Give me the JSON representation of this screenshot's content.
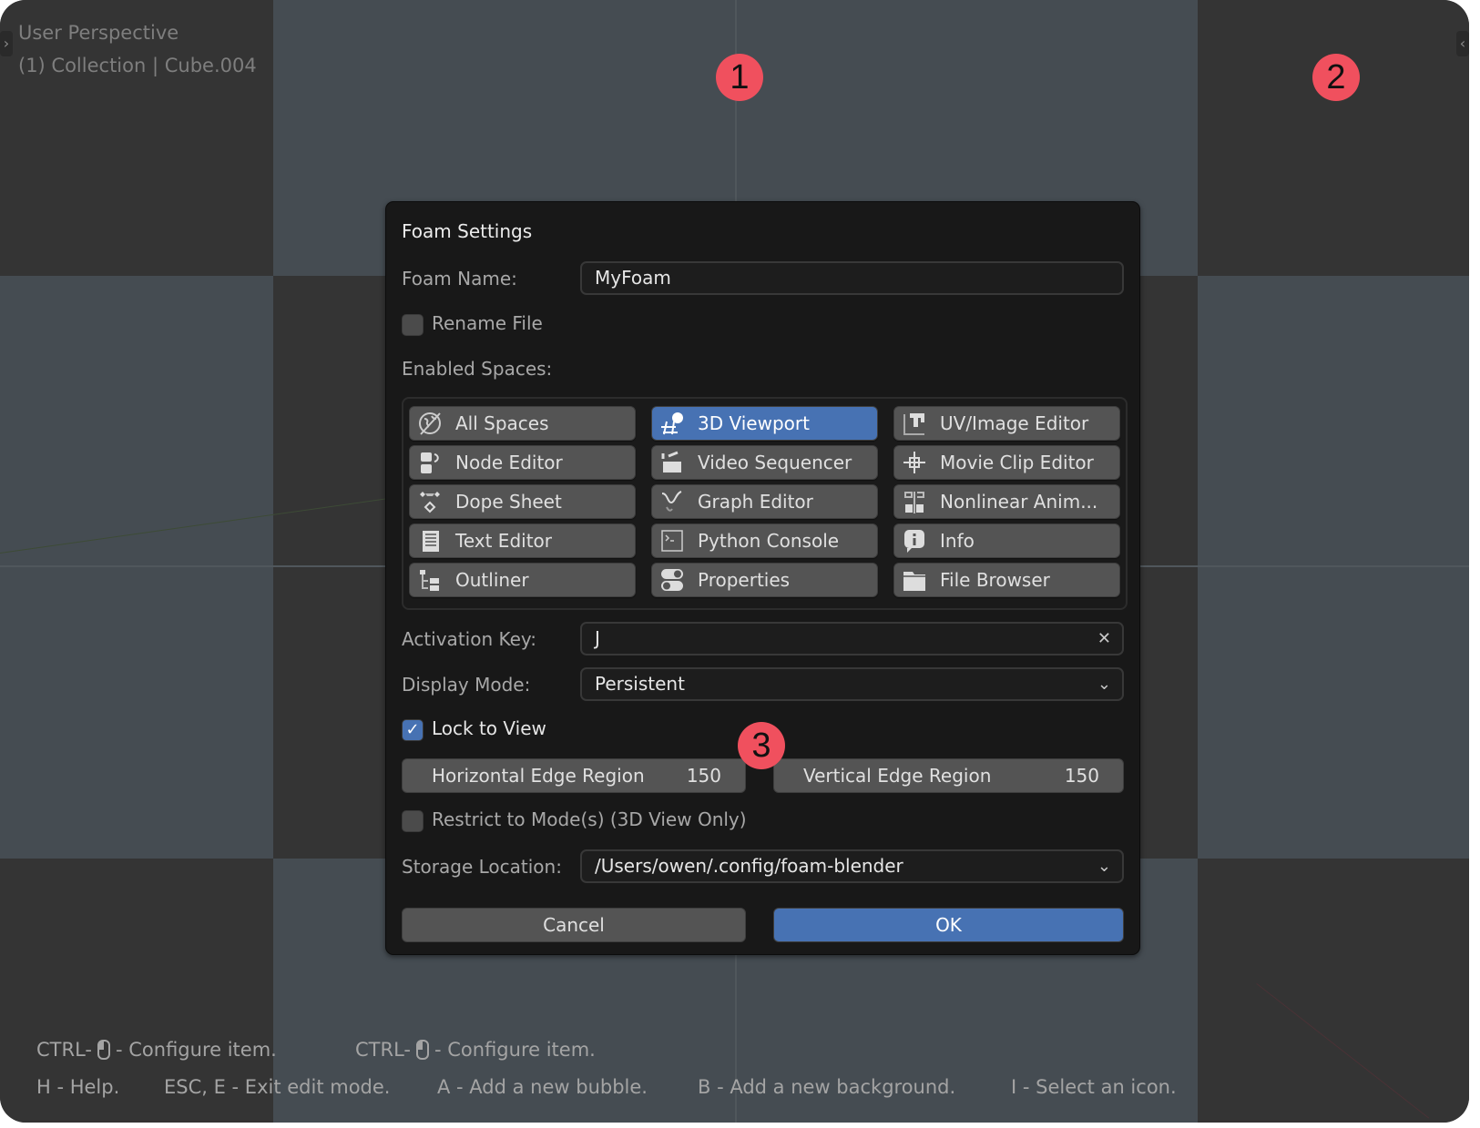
{
  "viewport": {
    "perspective_label": "User Perspective",
    "collection_label": "(1) Collection | Cube.004",
    "left_tab_icon": "chevron-right",
    "right_tab_icon": "chevron-left"
  },
  "badges": [
    "1",
    "2",
    "3"
  ],
  "dialog": {
    "title": "Foam Settings",
    "foam_name_label": "Foam Name:",
    "foam_name_value": "MyFoam",
    "rename_file_label": "Rename File",
    "rename_file_checked": false,
    "enabled_spaces_label": "Enabled Spaces:",
    "spaces": [
      {
        "label": "All Spaces",
        "icon": "globe-icon",
        "selected": false
      },
      {
        "label": "3D Viewport",
        "icon": "viewport-3d-icon",
        "selected": true
      },
      {
        "label": "UV/Image Editor",
        "icon": "image-editor-icon",
        "selected": false
      },
      {
        "label": "Node Editor",
        "icon": "node-editor-icon",
        "selected": false
      },
      {
        "label": "Video Sequencer",
        "icon": "clapper-icon",
        "selected": false
      },
      {
        "label": "Movie Clip Editor",
        "icon": "crosshair-icon",
        "selected": false
      },
      {
        "label": "Dope Sheet",
        "icon": "keyframe-icon",
        "selected": false
      },
      {
        "label": "Graph Editor",
        "icon": "curve-icon",
        "selected": false
      },
      {
        "label": "Nonlinear Anim...",
        "icon": "nla-icon",
        "selected": false
      },
      {
        "label": "Text Editor",
        "icon": "text-doc-icon",
        "selected": false
      },
      {
        "label": "Python Console",
        "icon": "console-icon",
        "selected": false
      },
      {
        "label": "Info",
        "icon": "info-icon",
        "selected": false
      },
      {
        "label": "Outliner",
        "icon": "outliner-icon",
        "selected": false
      },
      {
        "label": "Properties",
        "icon": "toggle-icon",
        "selected": false
      },
      {
        "label": "File Browser",
        "icon": "folder-icon",
        "selected": false
      }
    ],
    "activation_key_label": "Activation Key:",
    "activation_key_value": "J",
    "display_mode_label": "Display Mode:",
    "display_mode_value": "Persistent",
    "lock_to_view_label": "Lock to View",
    "lock_to_view_checked": true,
    "horizontal_edge_label": "Horizontal Edge Region",
    "horizontal_edge_value": "150",
    "vertical_edge_label": "Vertical Edge Region",
    "vertical_edge_value": "150",
    "restrict_mode_label": "Restrict to Mode(s) (3D View Only)",
    "restrict_mode_checked": false,
    "storage_label": "Storage Location:",
    "storage_value": "/Users/owen/.config/foam-blender",
    "cancel_label": "Cancel",
    "ok_label": "OK"
  },
  "hints": {
    "line1": [
      {
        "prefix": "CTRL-",
        "suffix": "- Configure item."
      },
      {
        "prefix": "CTRL-",
        "suffix": "- Configure item."
      }
    ],
    "line2": [
      "H - Help.",
      "ESC, E - Exit edit mode.",
      "A - Add a new bubble.",
      "B - Add a new background.",
      "I - Select an icon."
    ]
  },
  "colors": {
    "accent": "#4772b3",
    "badge": "#f0505e",
    "dialog_bg": "#181818",
    "button_bg": "#545454"
  }
}
